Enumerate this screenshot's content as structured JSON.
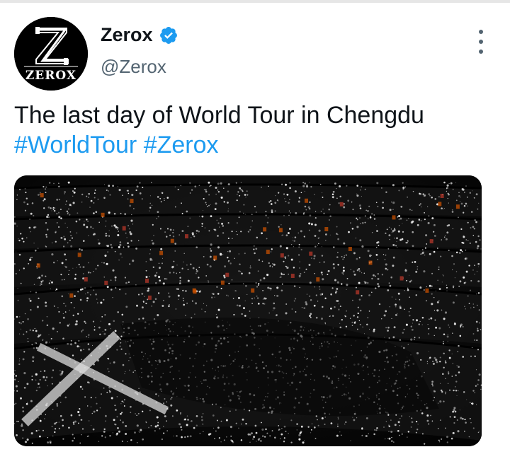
{
  "tweet": {
    "author": {
      "display_name": "Zerox",
      "handle": "@Zerox",
      "verified": true,
      "avatar_logo_text": "ZEROX",
      "avatar_monogram": "Z"
    },
    "text_line_1": "The last day of World Tour in Chengdu",
    "hashtags": [
      "#WorldTour",
      "#Zerox"
    ],
    "media": {
      "icon": "stadium-crowd-photo"
    }
  },
  "colors": {
    "text_primary": "#0f1419",
    "text_secondary": "#536471",
    "accent": "#1d9bf0",
    "verified_badge": "#1d9bf0"
  },
  "icons": {
    "more": "more-vertical-icon",
    "verified": "verified-badge-icon"
  }
}
